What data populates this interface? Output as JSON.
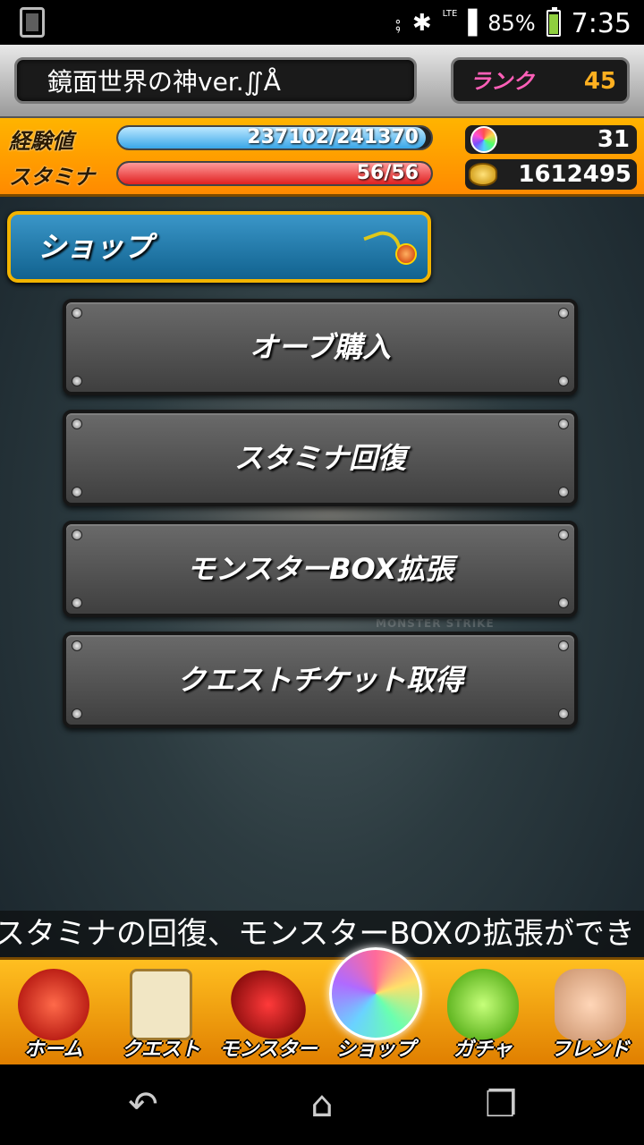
{
  "status_bar": {
    "lte": "LTE",
    "battery_percent": "85%",
    "time": "7:35",
    "battery_level": 0.85
  },
  "header": {
    "player_name": "鏡面世界の神ver.∬Å",
    "rank_label": "ランク",
    "rank_value": "45",
    "exp_label": "経験値",
    "exp_text": "237102/241370",
    "exp_fraction": 0.982,
    "stamina_label": "スタミナ",
    "stamina_text": "56/56",
    "stamina_fraction": 1.0,
    "orbs": "31",
    "coins": "1612495"
  },
  "section": {
    "title": "ショップ"
  },
  "menu": {
    "items": [
      {
        "label": "オーブ購入"
      },
      {
        "label": "スタミナ回復"
      },
      {
        "label": "モンスターBOX拡張"
      },
      {
        "label": "クエストチケット取得"
      }
    ]
  },
  "background": {
    "watermark": "MONSTER STRIKE"
  },
  "ticker": {
    "text": "スタミナの回復、モンスターBOXの拡張ができ"
  },
  "bottom_nav": {
    "items": [
      {
        "label": "ホーム",
        "icon": "home-icon"
      },
      {
        "label": "クエスト",
        "icon": "quest-icon"
      },
      {
        "label": "モンスター",
        "icon": "monster-icon"
      },
      {
        "label": "ショップ",
        "icon": "shop-icon"
      },
      {
        "label": "ガチャ",
        "icon": "gacha-icon"
      },
      {
        "label": "フレンド",
        "icon": "friend-icon"
      }
    ]
  },
  "colors": {
    "rank_label": "#ff5fb8",
    "rank_value": "#ffb020",
    "header_bar": "#ffb400",
    "section_title_bg": "#1f7aaa",
    "section_title_border": "#f2b400"
  }
}
